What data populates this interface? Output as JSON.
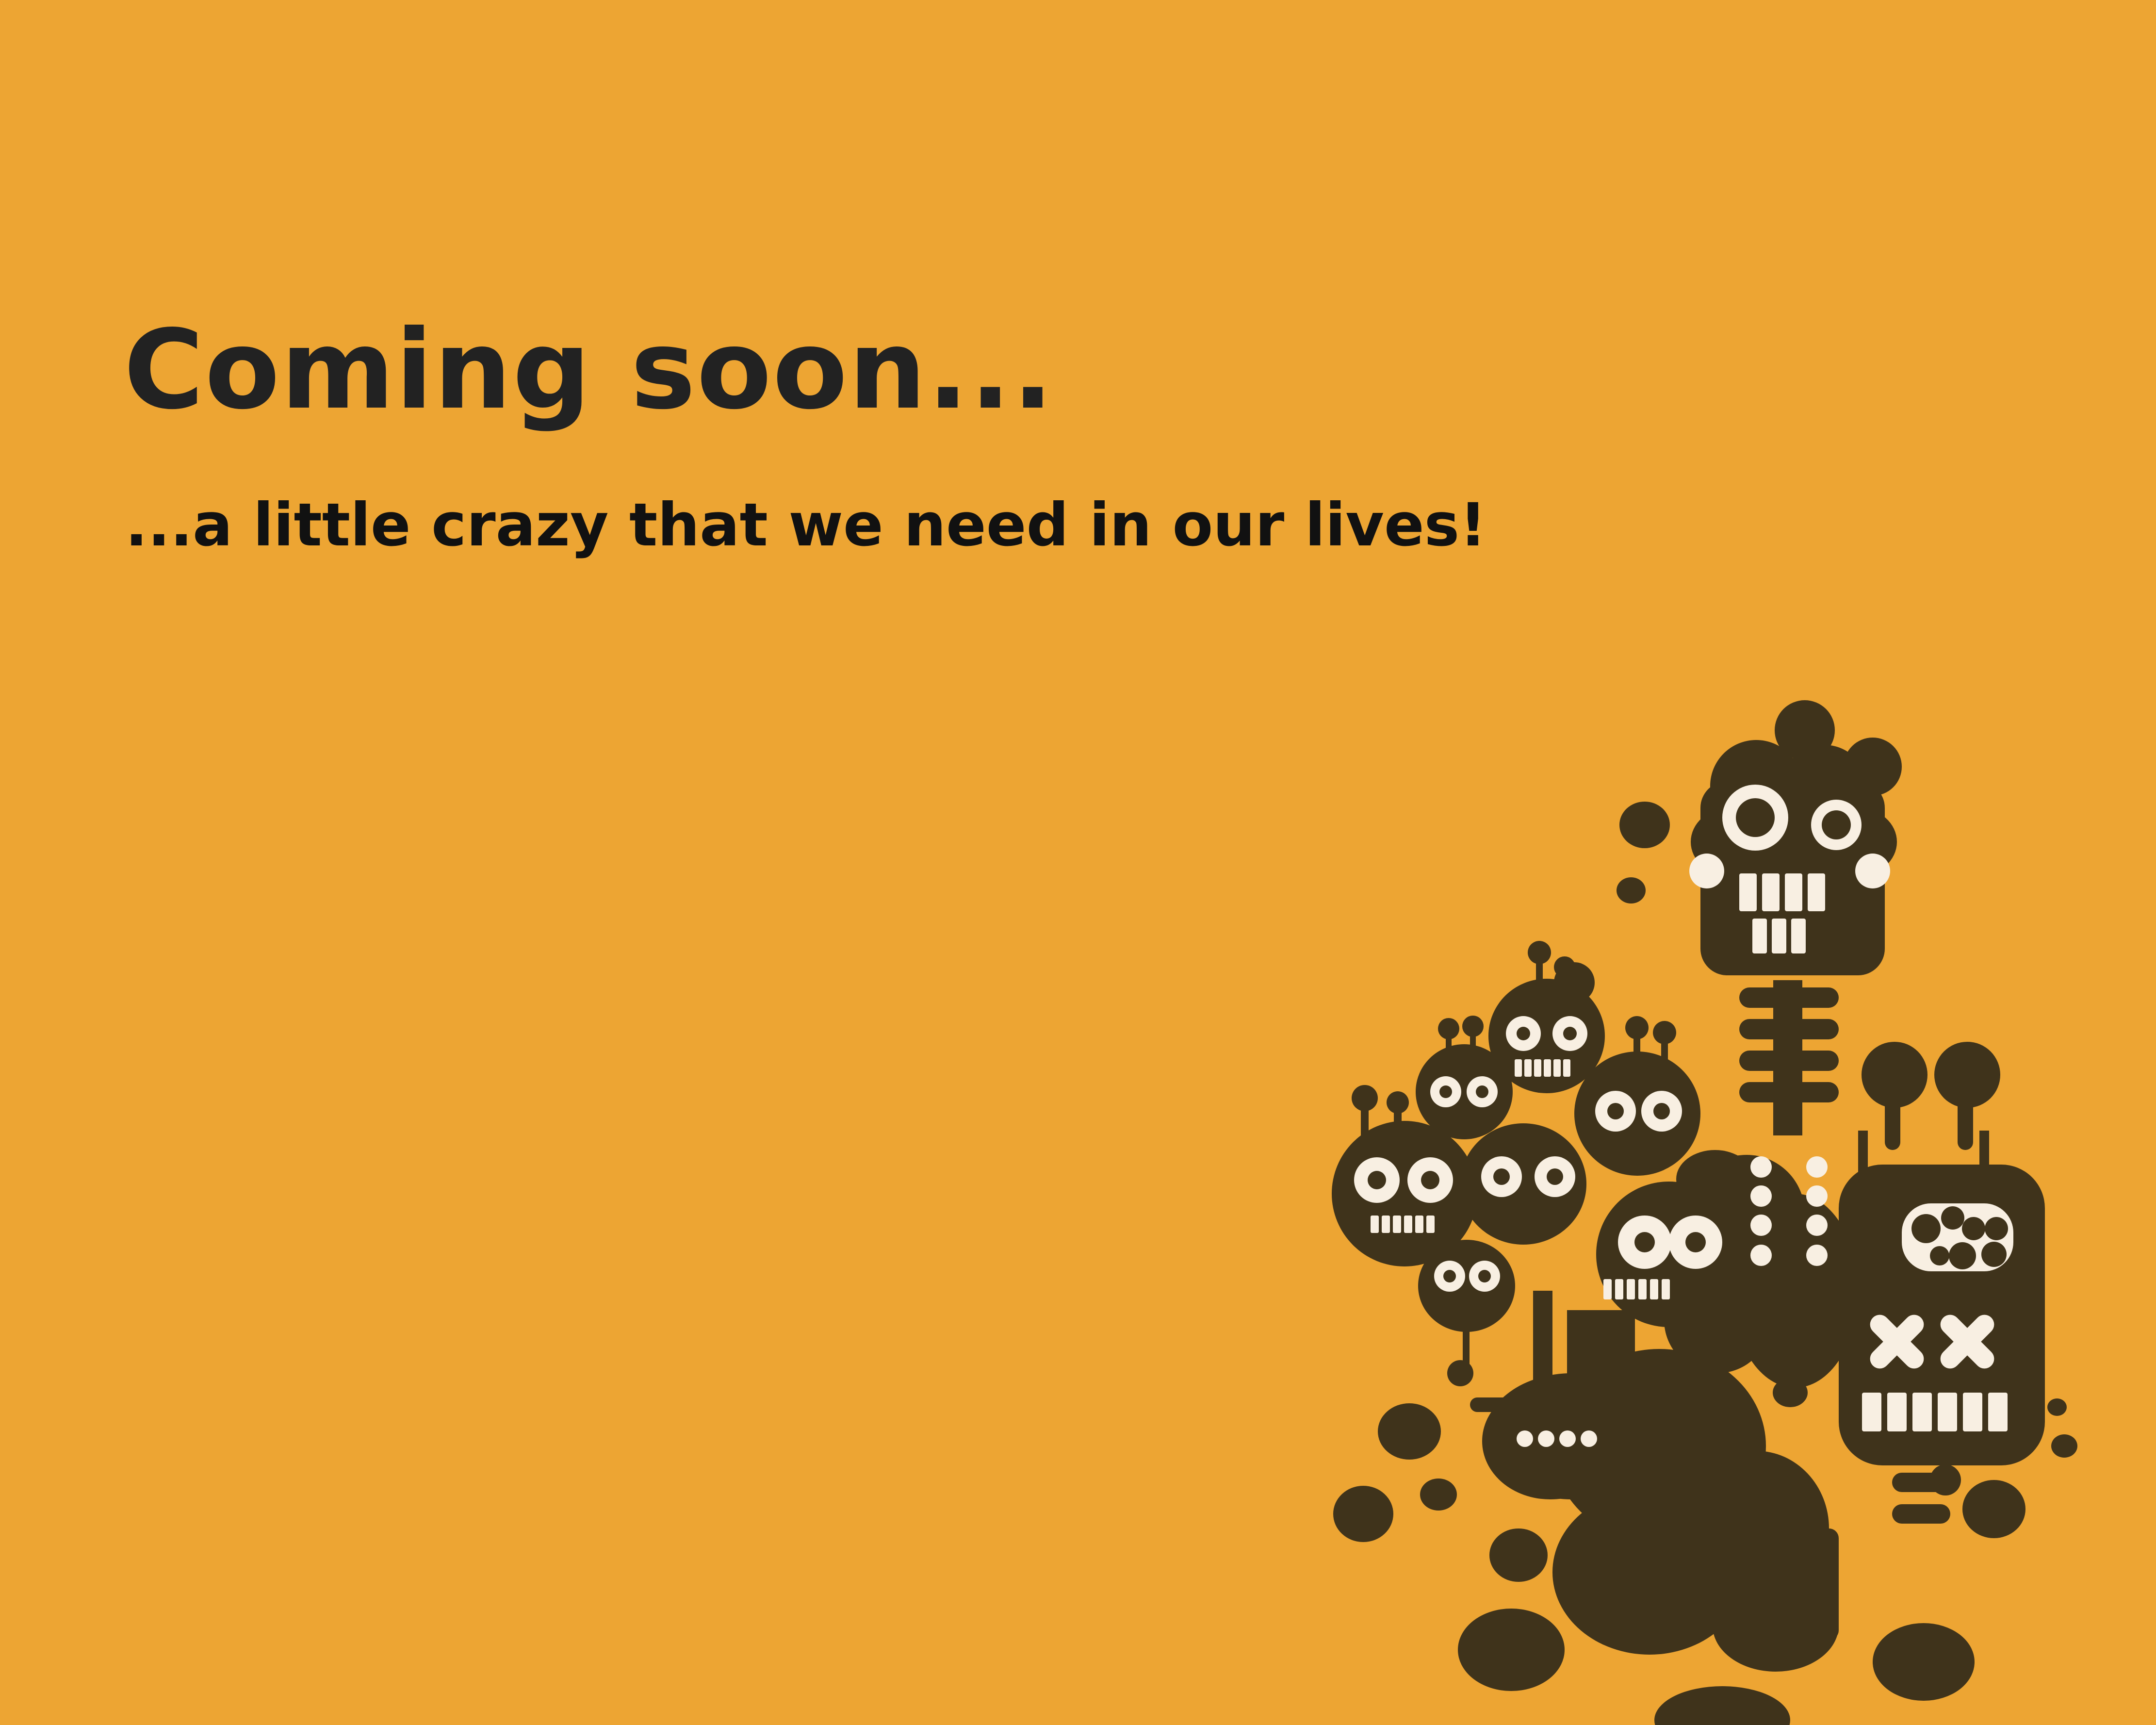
{
  "page": {
    "headline": "Coming soon...",
    "tagline": "...a little crazy that we need in our lives!"
  },
  "theme": {
    "background": "#EDA533",
    "text": "#222222",
    "illustration_dark": "#3F331B",
    "illustration_light": "#F8EFE2"
  },
  "illustration": {
    "icon": "monster-group-illustration"
  }
}
